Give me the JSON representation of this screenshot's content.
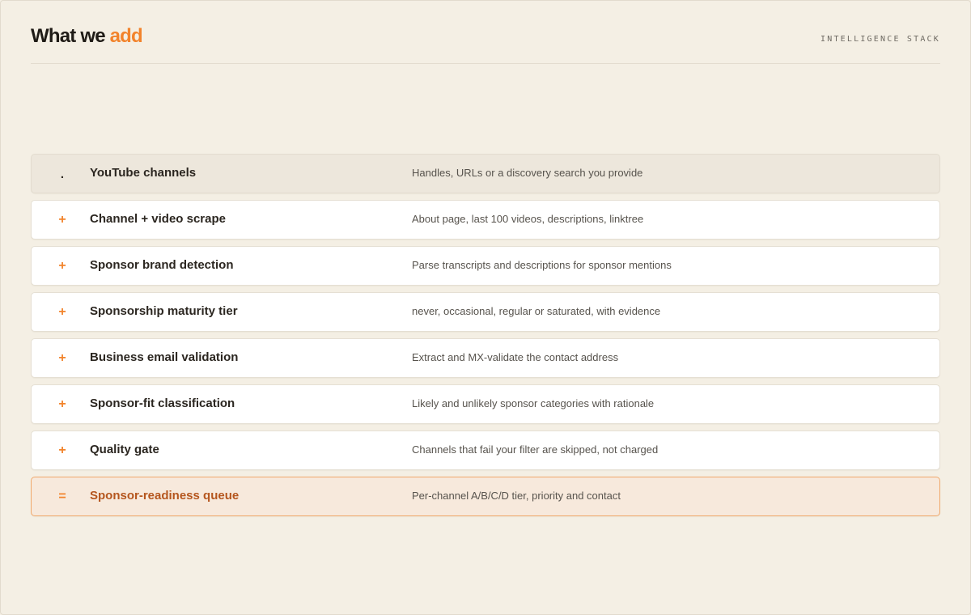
{
  "header": {
    "title_main": "What we",
    "title_accent": "add",
    "eyebrow": "INTELLIGENCE STACK"
  },
  "colors": {
    "background": "#f4efe4",
    "accent": "#f2832b",
    "result_text": "#b5561e",
    "result_background": "#f7e9dc"
  },
  "rows": [
    {
      "kind": "source",
      "marker": ".",
      "label": "YouTube channels",
      "description": "Handles, URLs or a discovery search you provide"
    },
    {
      "kind": "step",
      "marker": "+",
      "label": "Channel + video scrape",
      "description": "About page, last 100 videos, descriptions, linktree"
    },
    {
      "kind": "step",
      "marker": "+",
      "label": "Sponsor brand detection",
      "description": "Parse transcripts and descriptions for sponsor mentions"
    },
    {
      "kind": "step",
      "marker": "+",
      "label": "Sponsorship maturity tier",
      "description": "never, occasional, regular or saturated, with evidence"
    },
    {
      "kind": "step",
      "marker": "+",
      "label": "Business email validation",
      "description": "Extract and MX-validate the contact address"
    },
    {
      "kind": "step",
      "marker": "+",
      "label": "Sponsor-fit classification",
      "description": "Likely and unlikely sponsor categories with rationale"
    },
    {
      "kind": "step",
      "marker": "+",
      "label": "Quality gate",
      "description": "Channels that fail your filter are skipped, not charged"
    },
    {
      "kind": "result",
      "marker": "=",
      "label": "Sponsor-readiness queue",
      "description": "Per-channel A/B/C/D tier, priority and contact"
    }
  ]
}
